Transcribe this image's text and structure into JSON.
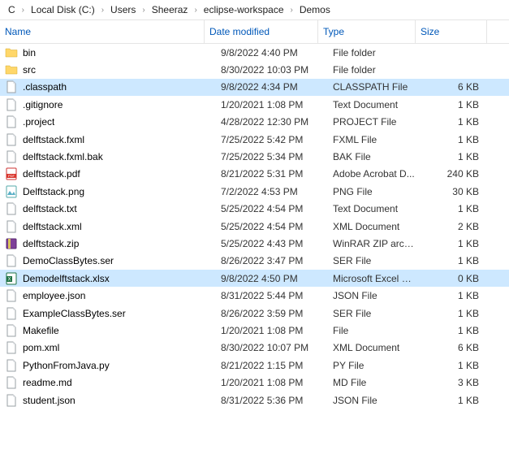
{
  "breadcrumb": [
    "C",
    "Local Disk (C:)",
    "Users",
    "Sheeraz",
    "eclipse-workspace",
    "Demos"
  ],
  "columns": {
    "name": "Name",
    "date": "Date modified",
    "type": "Type",
    "size": "Size"
  },
  "rows": [
    {
      "icon": "folder",
      "name": "bin",
      "date": "9/8/2022 4:40 PM",
      "type": "File folder",
      "size": "",
      "selected": false
    },
    {
      "icon": "folder",
      "name": "src",
      "date": "8/30/2022 10:03 PM",
      "type": "File folder",
      "size": "",
      "selected": false
    },
    {
      "icon": "file",
      "name": ".classpath",
      "date": "9/8/2022 4:34 PM",
      "type": "CLASSPATH File",
      "size": "6 KB",
      "selected": true
    },
    {
      "icon": "file",
      "name": ".gitignore",
      "date": "1/20/2021 1:08 PM",
      "type": "Text Document",
      "size": "1 KB",
      "selected": false
    },
    {
      "icon": "file",
      "name": ".project",
      "date": "4/28/2022 12:30 PM",
      "type": "PROJECT File",
      "size": "1 KB",
      "selected": false
    },
    {
      "icon": "file",
      "name": "delftstack.fxml",
      "date": "7/25/2022 5:42 PM",
      "type": "FXML File",
      "size": "1 KB",
      "selected": false
    },
    {
      "icon": "file",
      "name": "delftstack.fxml.bak",
      "date": "7/25/2022 5:34 PM",
      "type": "BAK File",
      "size": "1 KB",
      "selected": false
    },
    {
      "icon": "pdf",
      "name": "delftstack.pdf",
      "date": "8/21/2022 5:31 PM",
      "type": "Adobe Acrobat D...",
      "size": "240 KB",
      "selected": false
    },
    {
      "icon": "png",
      "name": "Delftstack.png",
      "date": "7/2/2022 4:53 PM",
      "type": "PNG File",
      "size": "30 KB",
      "selected": false
    },
    {
      "icon": "file",
      "name": "delftstack.txt",
      "date": "5/25/2022 4:54 PM",
      "type": "Text Document",
      "size": "1 KB",
      "selected": false
    },
    {
      "icon": "file",
      "name": "delftstack.xml",
      "date": "5/25/2022 4:54 PM",
      "type": "XML Document",
      "size": "2 KB",
      "selected": false
    },
    {
      "icon": "zip",
      "name": "delftstack.zip",
      "date": "5/25/2022 4:43 PM",
      "type": "WinRAR ZIP archive",
      "size": "1 KB",
      "selected": false
    },
    {
      "icon": "file",
      "name": "DemoClassBytes.ser",
      "date": "8/26/2022 3:47 PM",
      "type": "SER File",
      "size": "1 KB",
      "selected": false
    },
    {
      "icon": "xlsx",
      "name": "Demodelftstack.xlsx",
      "date": "9/8/2022 4:50 PM",
      "type": "Microsoft Excel W...",
      "size": "0 KB",
      "selected": true
    },
    {
      "icon": "file",
      "name": "employee.json",
      "date": "8/31/2022 5:44 PM",
      "type": "JSON File",
      "size": "1 KB",
      "selected": false
    },
    {
      "icon": "file",
      "name": "ExampleClassBytes.ser",
      "date": "8/26/2022 3:59 PM",
      "type": "SER File",
      "size": "1 KB",
      "selected": false
    },
    {
      "icon": "file",
      "name": "Makefile",
      "date": "1/20/2021 1:08 PM",
      "type": "File",
      "size": "1 KB",
      "selected": false
    },
    {
      "icon": "file",
      "name": "pom.xml",
      "date": "8/30/2022 10:07 PM",
      "type": "XML Document",
      "size": "6 KB",
      "selected": false
    },
    {
      "icon": "file",
      "name": "PythonFromJava.py",
      "date": "8/21/2022 1:15 PM",
      "type": "PY File",
      "size": "1 KB",
      "selected": false
    },
    {
      "icon": "file",
      "name": "readme.md",
      "date": "1/20/2021 1:08 PM",
      "type": "MD File",
      "size": "3 KB",
      "selected": false
    },
    {
      "icon": "file",
      "name": "student.json",
      "date": "8/31/2022 5:36 PM",
      "type": "JSON File",
      "size": "1 KB",
      "selected": false
    }
  ],
  "icons": {
    "chevron": "›"
  }
}
